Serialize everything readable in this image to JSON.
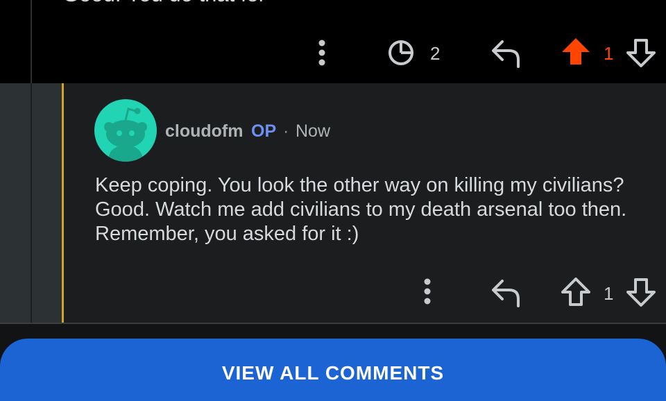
{
  "previous_comment": {
    "clipped_text": "Good. You do that for",
    "award_count": "2",
    "vote_count": "1",
    "upvoted_color": "#ff4500"
  },
  "comment": {
    "username": "cloudofm",
    "op_label": "OP",
    "separator": "·",
    "time": "Now",
    "body": "Keep coping. You look the other way on killing my civilians? Good. Watch me add civilians to my death arsenal too then. Remember, you asked for it :)",
    "vote_count": "1",
    "accent_color": "#d4a22a",
    "avatar_color": "#21d4b3"
  },
  "view_all_button": {
    "label": "VIEW ALL COMMENTS",
    "color": "#1c63d4"
  }
}
